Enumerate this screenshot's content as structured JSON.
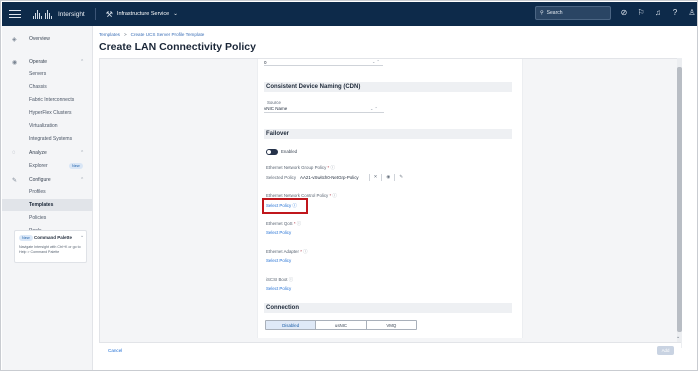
{
  "topbar": {
    "app_name": "Intersight",
    "service": "Infrastructure Service",
    "search_placeholder": "Search",
    "icons": [
      "check-circle-icon",
      "megaphone-icon",
      "bell-icon",
      "help-icon",
      "user-icon"
    ]
  },
  "sidebar": {
    "items": [
      {
        "label": "Overview",
        "icon": "overview-icon"
      },
      {
        "label": "Operate",
        "icon": "operate-icon"
      },
      {
        "label": "Servers"
      },
      {
        "label": "Chassis"
      },
      {
        "label": "Fabric Interconnects"
      },
      {
        "label": "HyperFlex Clusters"
      },
      {
        "label": "Virtualization"
      },
      {
        "label": "Integrated Systems"
      },
      {
        "label": "Analyze",
        "icon": "analyze-icon"
      },
      {
        "label": "Explorer",
        "badge": "New"
      },
      {
        "label": "Configure",
        "icon": "configure-icon"
      },
      {
        "label": "Profiles"
      },
      {
        "label": "Templates"
      },
      {
        "label": "Policies"
      },
      {
        "label": "Pools"
      }
    ],
    "command_palette": {
      "badge": "New",
      "title": "Command Palette",
      "desc": "Navigate Intersight with Ctrl+K or go to Help > Command Palette"
    }
  },
  "header": {
    "breadcrumb": [
      "Templates",
      "Create UCS Server Profile Template"
    ],
    "title": "Create LAN Connectivity Policy"
  },
  "form": {
    "top_value": "0",
    "cdn_section": "Consistent Device Naming (CDN)",
    "source_label": "Source",
    "source_value": "vNIC Name",
    "failover_section": "Failover",
    "enabled_label": "Enabled",
    "eth_group_label": "Ethernet Network Group Policy",
    "selected_policy_label": "Selected Policy",
    "selected_policy_value": "AA21-vSwitch0-NetGrp-Policy",
    "eth_control_label": "Ethernet Network Control Policy",
    "select_policy": "Select Policy",
    "eth_qos_label": "Ethernet QoS",
    "eth_adapter_label": "Ethernet Adapter",
    "iscsi_label": "iSCSI Boot",
    "connection_section": "Connection",
    "connection_options": [
      "Disabled",
      "usNIC",
      "VMQ"
    ],
    "connection_selected": "Disabled"
  },
  "footer": {
    "cancel": "Cancel",
    "add": "Add"
  },
  "colors": {
    "topbar": "#0d2a4a",
    "link": "#1f6ed4",
    "highlight": "#c0161c"
  }
}
